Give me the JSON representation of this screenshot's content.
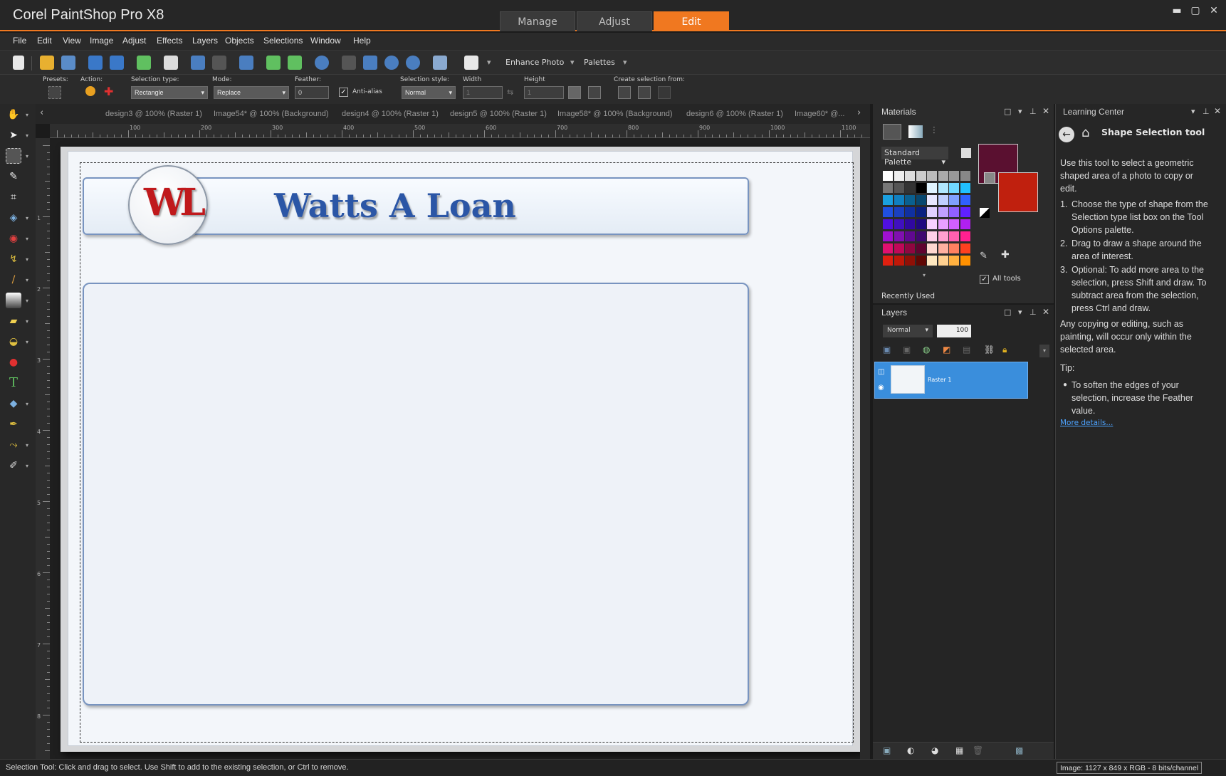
{
  "app": {
    "title": "Corel PaintShop Pro X8",
    "window_controls": [
      "minimize-icon",
      "maximize-icon",
      "close-icon"
    ]
  },
  "workspace_tabs": [
    {
      "label": "Manage"
    },
    {
      "label": "Adjust"
    },
    {
      "label": "Edit",
      "active": true
    }
  ],
  "menu": [
    "File",
    "Edit",
    "View",
    "Image",
    "Adjust",
    "Effects",
    "Layers",
    "Objects",
    "Selections",
    "Window",
    "Help"
  ],
  "toolbar": {
    "enhance_photo": "Enhance Photo",
    "palettes": "Palettes"
  },
  "tool_options": {
    "presets_label": "Presets:",
    "action_label": "Action:",
    "selection_type_label": "Selection type:",
    "selection_type_value": "Rectangle",
    "mode_label": "Mode:",
    "mode_value": "Replace",
    "feather_label": "Feather:",
    "feather_value": "0",
    "antialias_label": "Anti-alias",
    "antialias_checked": true,
    "selection_style_label": "Selection style:",
    "selection_style_value": "Normal",
    "width_label": "Width",
    "width_value": "1",
    "height_label": "Height",
    "height_value": "1",
    "create_from_label": "Create selection from:"
  },
  "doc_tabs": [
    "design3 @ 100% (Raster 1)",
    "Image54* @ 100% (Background)",
    "design4 @ 100% (Raster 1)",
    "design5 @ 100% (Raster 1)",
    "Image58* @ 100% (Background)",
    "design6 @ 100% (Raster 1)",
    "Image60* @..."
  ],
  "ruler": {
    "h_labels": [
      "100",
      "200",
      "300",
      "400",
      "500",
      "600",
      "700",
      "800",
      "900",
      "1000",
      "1100"
    ],
    "v_labels": [
      "1",
      "2",
      "3",
      "4",
      "5",
      "6",
      "7",
      "8"
    ]
  },
  "canvas": {
    "logo_text": "WL",
    "brand_text": "Watts A Loan"
  },
  "materials": {
    "title": "Materials",
    "palette_name": "Standard Palette",
    "recently_used": "Recently Used",
    "all_tools": "All tools",
    "all_tools_checked": true,
    "foreground_color": "#5a1030",
    "background_color": "#c0200e",
    "swatch_rows": [
      [
        "#ffffff",
        "#eeeeee",
        "#dddddd",
        "#cccccc",
        "#bbbbbb",
        "#aaaaaa",
        "#999999",
        "#888888"
      ],
      [
        "#777777",
        "#555555",
        "#333333",
        "#000000",
        "#e0f4ff",
        "#b0e8ff",
        "#70d8ff",
        "#20c0ff"
      ],
      [
        "#1aa0e0",
        "#1080c0",
        "#0a6090",
        "#084870",
        "#e8e8ff",
        "#c0d0ff",
        "#80a0ff",
        "#3060ff"
      ],
      [
        "#2050e0",
        "#1a40c0",
        "#1030a0",
        "#0a2080",
        "#e0d0ff",
        "#c0a0ff",
        "#9060ff",
        "#6020ff"
      ],
      [
        "#5010e0",
        "#4010c0",
        "#3008a0",
        "#200880",
        "#f8d0ff",
        "#e8a0ff",
        "#d060ff",
        "#b020f0"
      ],
      [
        "#a010d0",
        "#8010b0",
        "#600890",
        "#400870",
        "#ffd0e8",
        "#ffa0d0",
        "#ff60b0",
        "#ff2090"
      ],
      [
        "#e01070",
        "#c00858",
        "#900640",
        "#600430",
        "#ffd8d0",
        "#ffb0a0",
        "#ff8060",
        "#ff4020"
      ],
      [
        "#e02010",
        "#c01808",
        "#901006",
        "#600804",
        "#ffe8c0",
        "#ffd090",
        "#ffb040",
        "#ff9000"
      ]
    ]
  },
  "layers": {
    "title": "Layers",
    "blend_mode": "Normal",
    "opacity": "100",
    "items": [
      {
        "name": "Raster 1",
        "selected": true
      }
    ]
  },
  "learning_center": {
    "title": "Learning Center",
    "tool_title": "Shape Selection tool",
    "intro": "Use this tool to select a geometric shaped area of a photo to copy or edit.",
    "steps": [
      "Choose the type of shape from the Selection type list box on the Tool Options palette.",
      "Drag to draw a shape around the area of interest.",
      "Optional: To add more area to the selection, press Shift and draw. To subtract area from the selection, press Ctrl and draw."
    ],
    "note": "Any copying or editing, such as painting, will occur only within the selected area.",
    "tip_label": "Tip:",
    "tip": "To soften the edges of your selection, increase the Feather value.",
    "more_link": "More details..."
  },
  "status": {
    "text": "Selection Tool: Click and drag to select. Use Shift to add to the existing selection, or Ctrl to remove.",
    "image_info": "Image:  1127 x 849 x RGB - 8 bits/channel"
  }
}
